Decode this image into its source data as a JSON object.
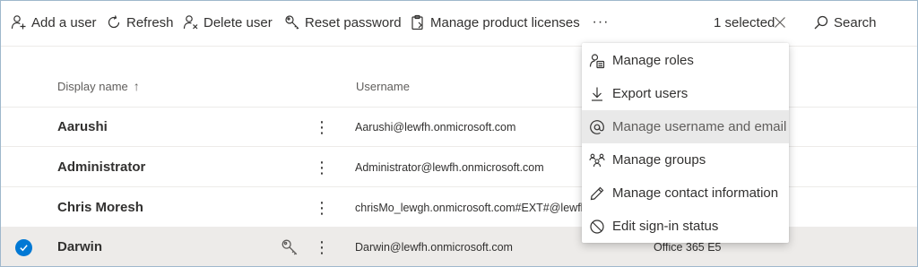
{
  "toolbar": {
    "add_user": "Add a user",
    "refresh": "Refresh",
    "delete_user": "Delete user",
    "reset_password": "Reset password",
    "manage_licenses": "Manage product licenses",
    "more": "···",
    "selected": "1 selected",
    "clear": "✕",
    "search": "Search"
  },
  "table": {
    "headers": {
      "display_name": "Display name",
      "sort_arrow": "↑",
      "username": "Username"
    },
    "rows": [
      {
        "name": "Aarushi",
        "username": "Aarushi@lewfh.onmicrosoft.com",
        "license": "",
        "selected": false
      },
      {
        "name": "Administrator",
        "username": "Administrator@lewfh.onmicrosoft.com",
        "license": "",
        "selected": false
      },
      {
        "name": "Chris Moresh",
        "username": "chrisMo_lewgh.onmicrosoft.com#EXT#@lewfh",
        "license": "",
        "selected": false
      },
      {
        "name": "Darwin",
        "username": "Darwin@lewfh.onmicrosoft.com",
        "license": "Office 365 E5",
        "selected": true
      }
    ],
    "kebab": "⋮"
  },
  "menu": {
    "items": [
      {
        "label": "Manage roles",
        "icon": "person-roles-icon"
      },
      {
        "label": "Export users",
        "icon": "download-icon"
      },
      {
        "label": "Manage username and email",
        "icon": "at-sign-icon",
        "hovered": true
      },
      {
        "label": "Manage groups",
        "icon": "group-icon"
      },
      {
        "label": "Manage contact information",
        "icon": "pencil-icon"
      },
      {
        "label": "Edit sign-in status",
        "icon": "blocked-icon"
      }
    ]
  },
  "colors": {
    "accent": "#0078d4",
    "selected_row": "#edebe9",
    "menu_hover": "#e9e9e9",
    "frame_border": "#9fb8cc"
  }
}
